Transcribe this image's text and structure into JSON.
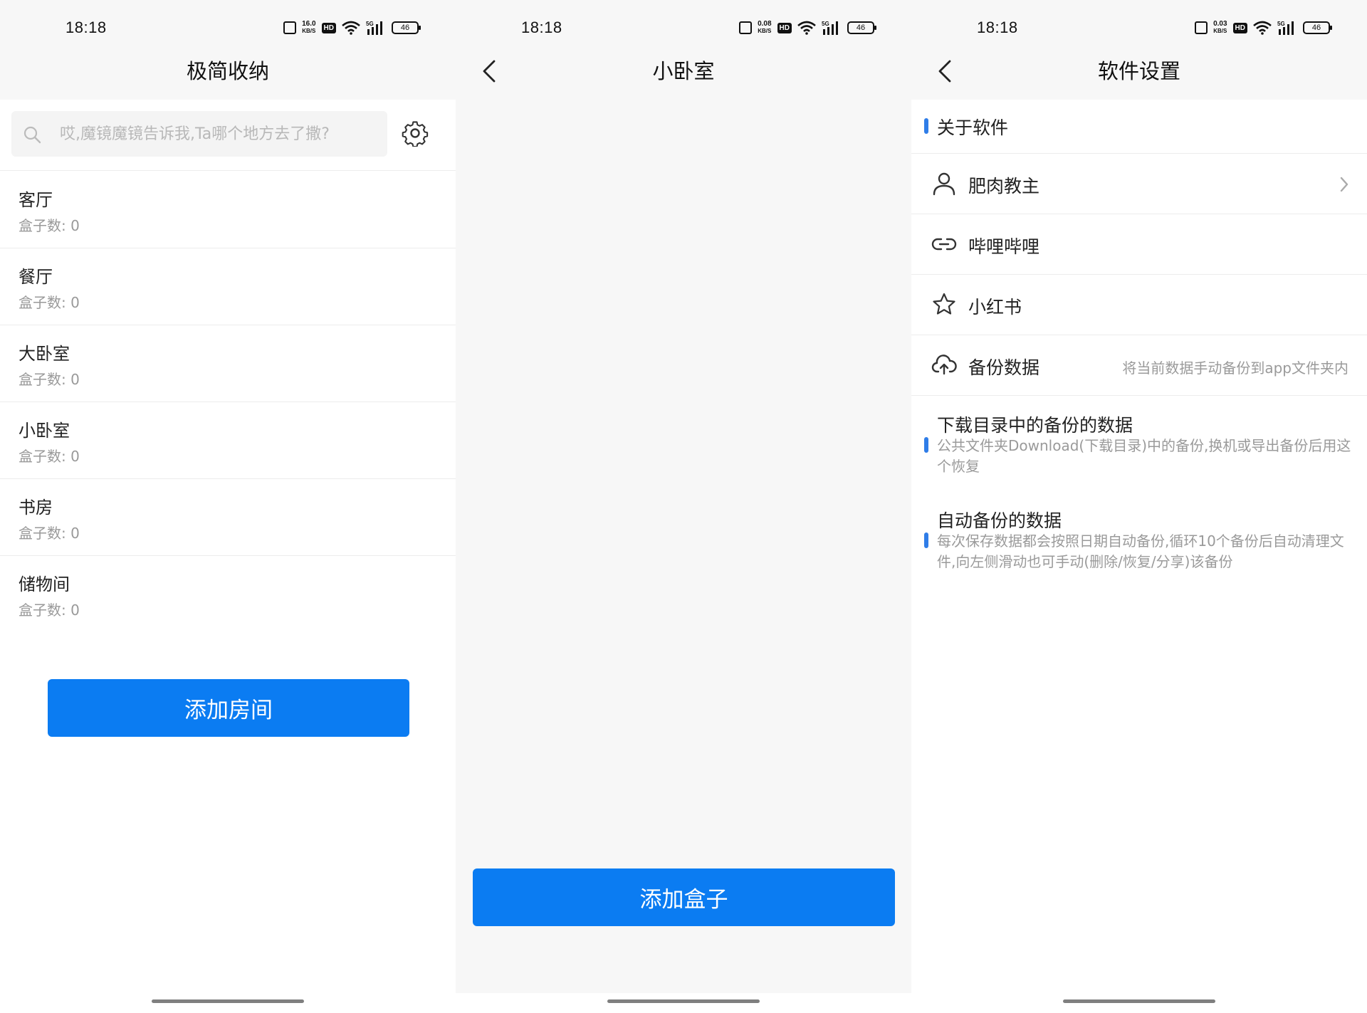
{
  "status_bar": [
    {
      "time": "18:18",
      "speed_top": "16.0",
      "speed_unit": "KB/S",
      "hd": "HD",
      "signal": "5G",
      "battery": "46"
    },
    {
      "time": "18:18",
      "speed_top": "0.08",
      "speed_unit": "KB/S",
      "hd": "HD",
      "signal": "5G",
      "battery": "46"
    },
    {
      "time": "18:18",
      "speed_top": "0.03",
      "speed_unit": "KB/S",
      "hd": "HD",
      "signal": "5G",
      "battery": "46"
    }
  ],
  "screen1": {
    "title": "极简收纳",
    "search_placeholder": "哎,魔镜魔镜告诉我,Ta哪个地方去了撒?",
    "rooms": [
      {
        "name": "客厅",
        "count": "盒子数: 0"
      },
      {
        "name": "餐厅",
        "count": "盒子数: 0"
      },
      {
        "name": "大卧室",
        "count": "盒子数: 0"
      },
      {
        "name": "小卧室",
        "count": "盒子数: 0"
      },
      {
        "name": "书房",
        "count": "盒子数: 0"
      },
      {
        "name": "储物间",
        "count": "盒子数: 0"
      }
    ],
    "add_button": "添加房间"
  },
  "screen2": {
    "title": "小卧室",
    "add_button": "添加盒子"
  },
  "screen3": {
    "title": "软件设置",
    "about_header": "关于软件",
    "rows": [
      {
        "label": "肥肉教主",
        "icon": "user-icon"
      },
      {
        "label": "哔哩哔哩",
        "icon": "link-icon"
      },
      {
        "label": "小红书",
        "icon": "star-icon"
      },
      {
        "label": "备份数据",
        "icon": "cloud-upload-icon",
        "note": "将当前数据手动备份到app文件夹内"
      }
    ],
    "download_backup": {
      "title": "下载目录中的备份的数据",
      "desc": "公共文件夹Download(下载目录)中的备份,换机或导出备份后用这个恢复"
    },
    "auto_backup": {
      "title": "自动备份的数据",
      "desc": "每次保存数据都会按照日期自动备份,循环10个备份后自动清理文件,向左侧滑动也可手动(删除/恢复/分享)该备份"
    }
  },
  "colors": {
    "primary": "#0b7cf2",
    "accent": "#2f7de8",
    "background": "#f7f7f7"
  }
}
